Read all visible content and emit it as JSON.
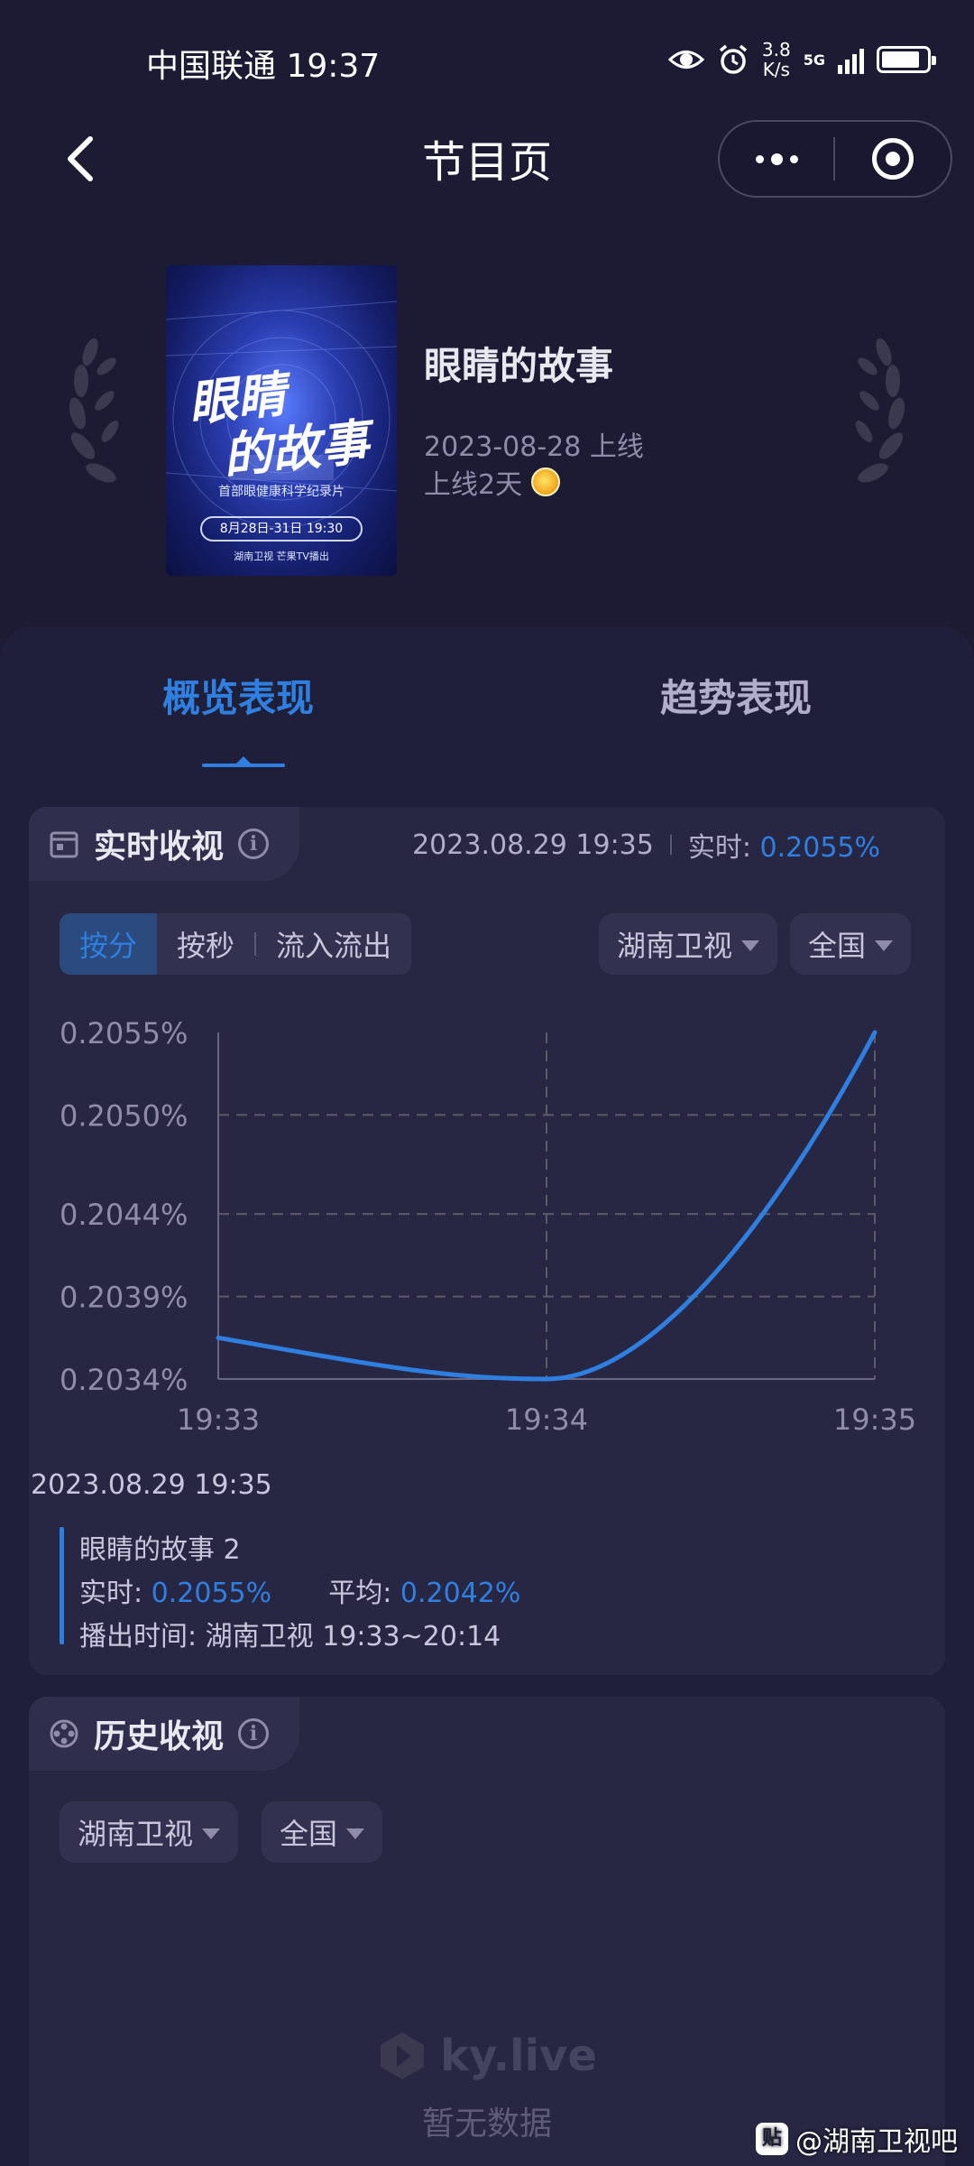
{
  "status_bar": {
    "carrier_time": "中国联通 19:37",
    "net_speed_value": "3.8",
    "net_speed_unit": "K/s",
    "network": "5G",
    "signal_icon": "signal-icon",
    "battery_icon": "battery-icon",
    "battery_level": 0.85
  },
  "nav": {
    "title": "节目页",
    "back_icon": "chevron-left-icon",
    "more_icon": "more-dots-icon",
    "close_icon": "target-icon"
  },
  "program": {
    "title": "眼睛的故事",
    "online_date": "2023-08-28 上线",
    "online_days": "上线2天",
    "poster": {
      "title_line1": "眼睛",
      "title_line2": "的故事",
      "subtitle": "首部眼健康科学纪录片",
      "air_time": "8月28日-31日 19:30",
      "channels": "湖南卫视 芒果TV播出"
    }
  },
  "tabs": [
    {
      "label": "概览表现",
      "active": true
    },
    {
      "label": "趋势表现",
      "active": false
    }
  ],
  "realtime": {
    "title": "实时收视",
    "timestamp": "2023.08.29 19:35",
    "realtime_label": "实时:",
    "realtime_value": "0.2055%",
    "segments": [
      "按分",
      "按秒",
      "流入流出"
    ],
    "active_segment": "按分",
    "channel_dropdown": "湖南卫视",
    "region_dropdown": "全国",
    "tooltip": {
      "time": "2023.08.29 19:35",
      "series_name": "眼睛的故事 2",
      "realtime_label": "实时:",
      "realtime_value": "0.2055%",
      "average_label": "平均:",
      "average_value": "0.2042%",
      "airtime_label": "播出时间:",
      "airtime_value": "湖南卫视 19:33~20:14"
    }
  },
  "history": {
    "title": "历史收视",
    "channel_dropdown": "湖南卫视",
    "region_dropdown": "全国",
    "empty_brand": "ky.live",
    "empty_text": "暂无数据"
  },
  "watermark": {
    "tieba_icon_text": "贴",
    "tieba_text": "@湖南卫视吧"
  },
  "colors": {
    "accent": "#2f7fe0",
    "background": "#1d1b33",
    "panel": "#272744"
  },
  "chart_data": {
    "type": "line",
    "x": [
      "19:33",
      "19:34",
      "19:35"
    ],
    "ytick_labels": [
      "0.2055%",
      "0.2050%",
      "0.2044%",
      "0.2039%",
      "0.2034%"
    ],
    "ytick_values": [
      0.2055,
      0.205,
      0.2044,
      0.2039,
      0.2034
    ],
    "ylim": [
      0.2034,
      0.2055
    ],
    "series": [
      {
        "name": "眼睛的故事 2",
        "values": [
          0.20365,
          0.2034,
          0.2055
        ]
      }
    ],
    "grid": true,
    "title": "",
    "xlabel": "",
    "ylabel": ""
  }
}
